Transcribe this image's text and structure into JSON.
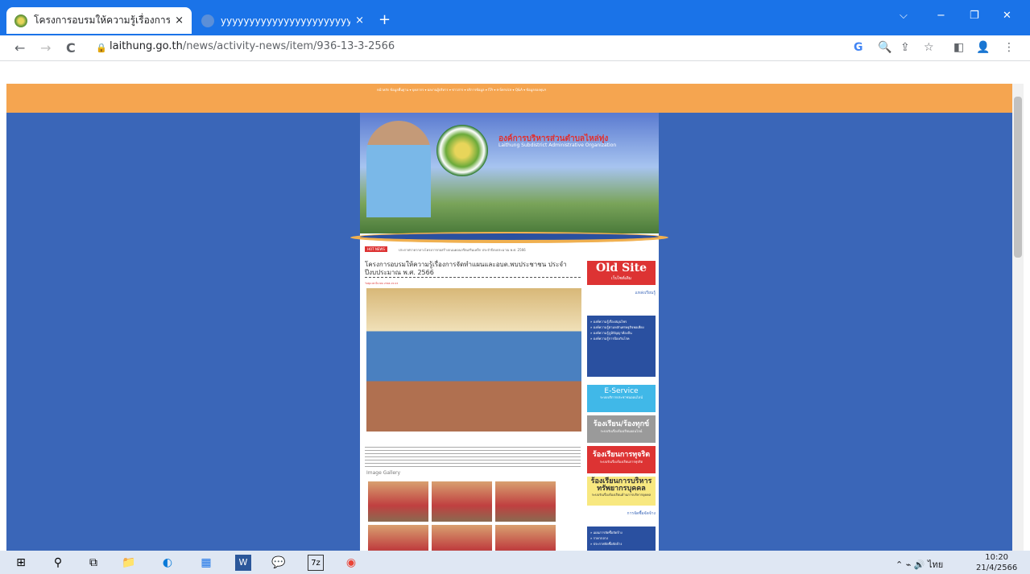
{
  "tabs": [
    {
      "title": "โครงการอบรมให้ความรู้เรื่องการจัดทำแ",
      "close": "×"
    },
    {
      "title": "yyyyyyyyyyyyyyyyyyyyyyyyyyyyyyyy",
      "close": "×"
    }
  ],
  "new_tab": "+",
  "window_controls": {
    "dropdown": "⌵",
    "minimize": "−",
    "restore": "❐",
    "close": "✕"
  },
  "nav": {
    "back": "←",
    "forward": "→",
    "reload": "C"
  },
  "address": {
    "host": "laithung.go.th",
    "path": "/news/activity-news/item/936-13-3-2566"
  },
  "toolbar_icons": [
    "G",
    "🔍",
    "⇪",
    "☆",
    "◧",
    "👤",
    "⋮"
  ],
  "site": {
    "menu": "หน้าหลัก ข้อมูลพื้นฐาน ▾ บุคลากร ▾ ผลงานผู้บริหาร ▾ ข่าวสาร ▾ บริการข้อมูล ▾ ITA ▾ e-Service ▾ Q&A ▾ ข้อมูลกองทุนฯ",
    "org_name": "องค์การบริหารส่วนตำบลไหล่ทุ่ง",
    "org_en": "Laithung Subdistrict Administrative Organization",
    "hot_news_label": "HOT NEWS",
    "hot_news_text": "ประกาศราคากลางโครงการก่อสร้างถนนคอนกรีตเสริมเหล็ก ประจำปีงบประมาณ พ.ศ. 2566",
    "news_title": "โครงการอบรมให้ความรู้เรื่องการจัดทำแผนและอบต.พบประชาชน ประจำปีงบประมาณ พ.ศ. 2566",
    "news_date": "วันพุธ 08 มีนาคม 2566 15:03",
    "gallery_title": "Image Gallery",
    "sidebar": {
      "old_site": "Old Site",
      "old_site_sub": "เว็บไซต์เดิม",
      "knowledge": "แหล่งเรียนรู้",
      "knowledge_links": [
        "» องค์ความรู้เรื่องสมุนไพร",
        "» องค์ความรู้ตามหลักเศรษฐกิจพอเพียง",
        "» องค์ความรู้ภูมิปัญญาท้องถิ่น",
        "» องค์ความรู้การป้องกันโรค"
      ],
      "eservice": "E-Service",
      "eservice_sub": "ระบบบริการประชาชนออนไลน์",
      "rong1": "ร้องเรียน/ร้องทุกข์",
      "rong1_sub": "ระบบรับเรื่องร้องเรียนออนไลน์",
      "rong2": "ร้องเรียนการทุจริต",
      "rong2_sub": "ระบบรับเรื่องร้องเรียนการทุจริต",
      "rong3": "ร้องเรียนการบริหาร ทรัพยากรบุคคล",
      "rong3_sub": "ระบบรับเรื่องร้องเรียนด้านการบริหารบุคคล",
      "links2": "การจัดซื้อจัดจ้าง",
      "links2_items": [
        "» แผนการจัดซื้อจัดจ้าง",
        "» ราคากลาง",
        "» ประกาศจัดซื้อจัดจ้าง"
      ]
    }
  },
  "taskbar": {
    "icons": [
      "⊞",
      "⚲",
      "⧉",
      "📁",
      "◐",
      "▦",
      "W",
      "💬",
      "7z",
      "◉"
    ],
    "tray": "⌃  ⌁ 🔊  ไทย",
    "time": "10:20",
    "date": "21/4/2566"
  }
}
